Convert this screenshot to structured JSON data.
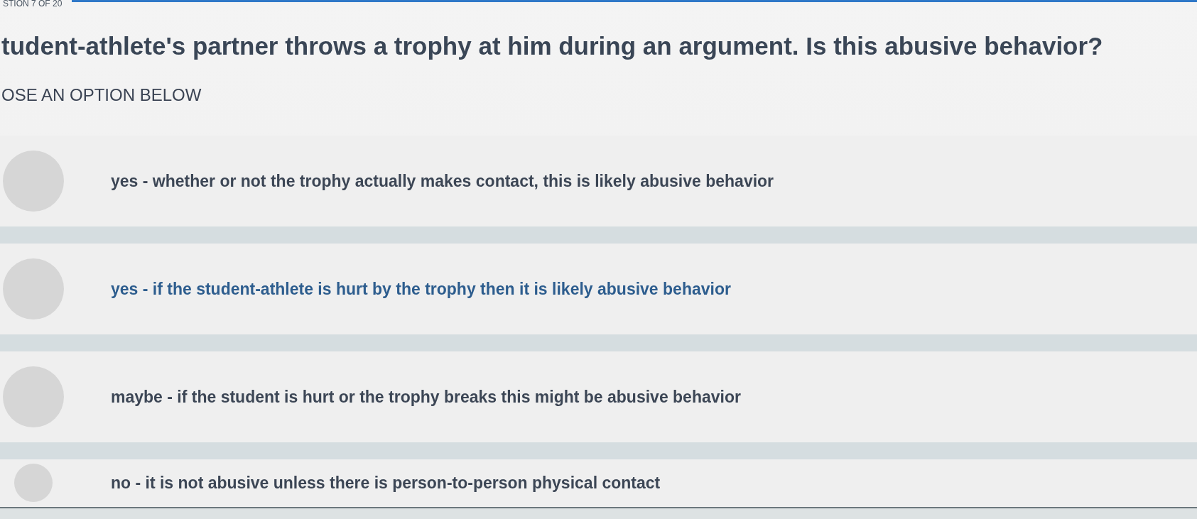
{
  "progress": {
    "label": "STION 7 OF 20"
  },
  "question": {
    "text": "tudent-athlete's partner throws a trophy at him during an argument. Is this abusive behavior?"
  },
  "instruction": "OSE AN OPTION BELOW",
  "options": [
    {
      "text": "yes - whether or not the trophy actually makes contact, this is likely abusive behavior",
      "selected": false,
      "highlighted": false
    },
    {
      "text": "yes - if the student-athlete is hurt by the trophy then it is likely abusive behavior",
      "selected": false,
      "highlighted": true
    },
    {
      "text": "maybe - if the student is hurt or the trophy breaks this might be abusive behavior",
      "selected": false,
      "highlighted": false
    },
    {
      "text": "no - it is not abusive unless there is person-to-person physical contact",
      "selected": false,
      "highlighted": false
    }
  ]
}
